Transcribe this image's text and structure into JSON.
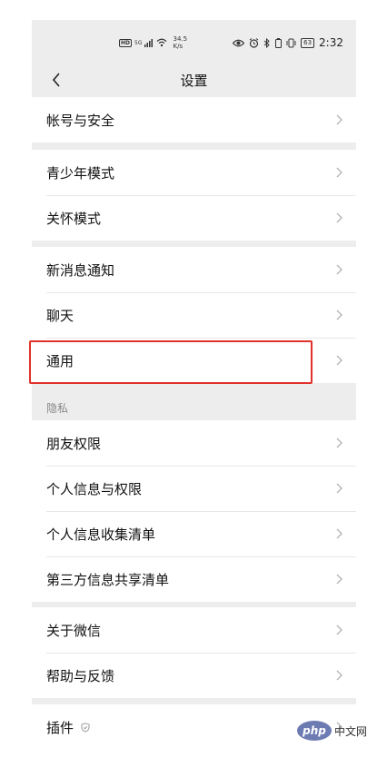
{
  "status_bar": {
    "hd": "HD",
    "network": "5G",
    "speed_value": "34.5",
    "speed_unit": "K/s",
    "battery": "63",
    "time": "2:32"
  },
  "nav": {
    "title": "设置"
  },
  "groups": {
    "account": [
      "帐号与安全"
    ],
    "modes": [
      "青少年模式",
      "关怀模式"
    ],
    "general": [
      "新消息通知",
      "聊天",
      "通用"
    ],
    "privacy_label": "隐私",
    "privacy": [
      "朋友权限",
      "个人信息与权限",
      "个人信息收集清单",
      "第三方信息共享清单"
    ],
    "about": [
      "关于微信",
      "帮助与反馈"
    ],
    "plugins": [
      "插件"
    ]
  },
  "highlight_target": "通用",
  "watermark": {
    "logo": "php",
    "text": "中文网"
  },
  "colors": {
    "background": "#ededed",
    "highlight": "#e0322b"
  }
}
